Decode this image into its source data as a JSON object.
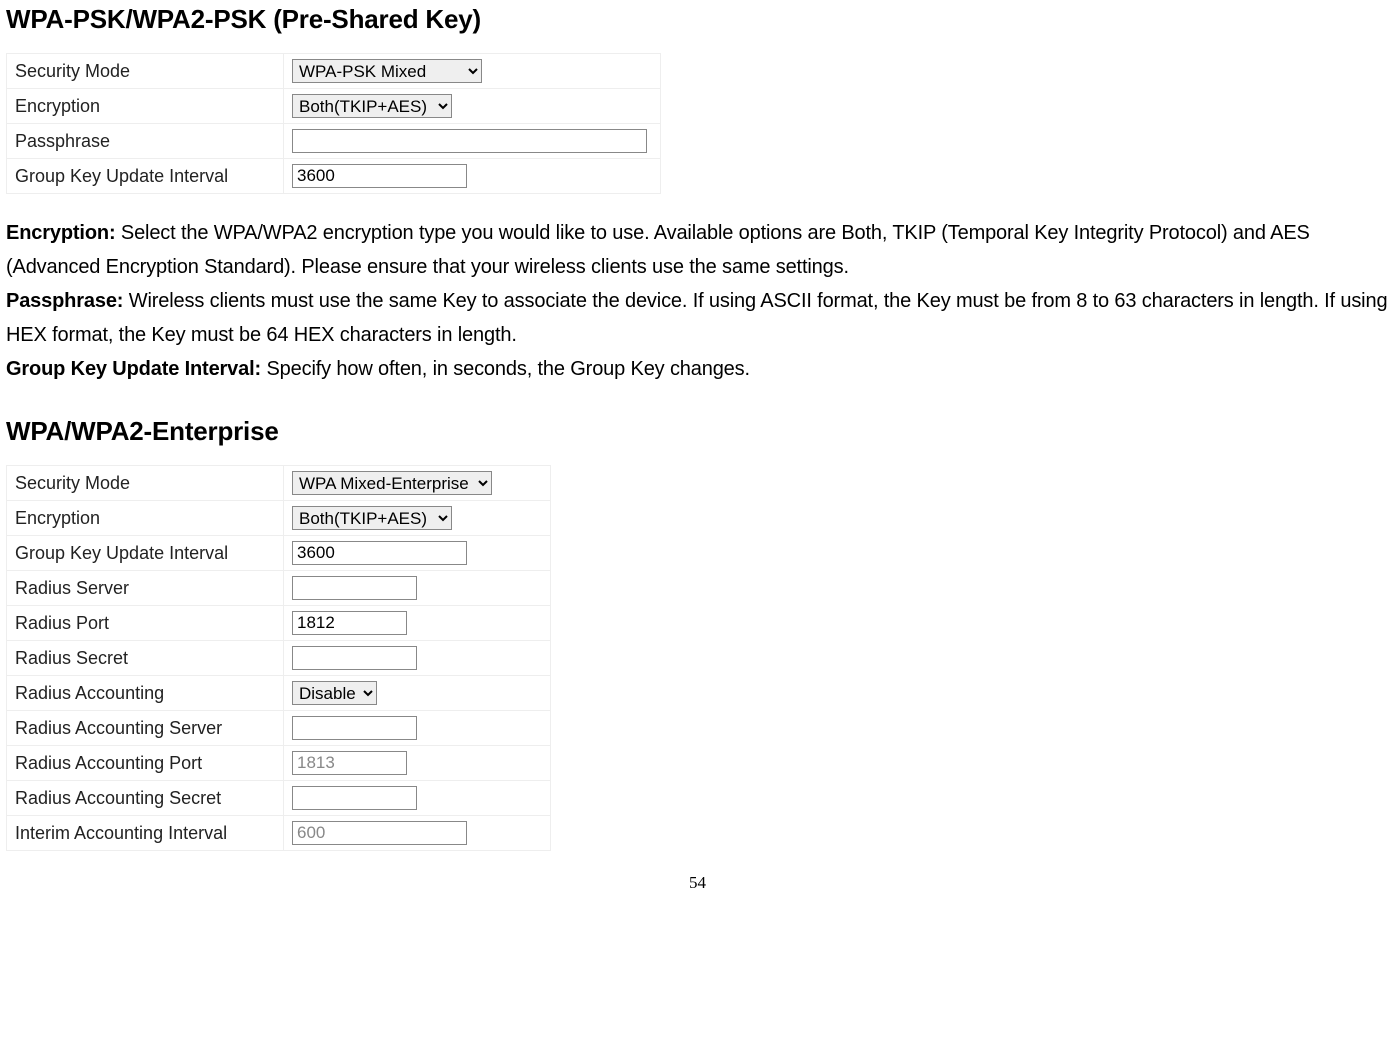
{
  "section1": {
    "title": "WPA-PSK/WPA2-PSK (Pre-Shared Key)",
    "rows": {
      "security_mode": {
        "label": "Security Mode",
        "value": "WPA-PSK Mixed"
      },
      "encryption": {
        "label": "Encryption",
        "value": "Both(TKIP+AES)"
      },
      "passphrase": {
        "label": "Passphrase",
        "value": ""
      },
      "gkui": {
        "label": "Group Key Update Interval",
        "value": "3600"
      }
    }
  },
  "descr": {
    "enc_label": "Encryption:",
    "enc_text": " Select the WPA/WPA2 encryption type you would like to use. Available options are Both, TKIP (Temporal Key Integrity Protocol) and AES (Advanced Encryption Standard). Please ensure that your wireless clients use the same settings.",
    "pass_label": "Passphrase:",
    "pass_text": " Wireless clients must use the same Key to associate the device. If using ASCII format, the Key must be from 8 to 63 characters in length. If using HEX format, the Key must be 64 HEX characters in length.",
    "gkui_label": "Group Key Update Interval:",
    "gkui_text": " Specify how often, in seconds, the Group Key changes."
  },
  "section2": {
    "title": "WPA/WPA2-Enterprise",
    "rows": {
      "security_mode": {
        "label": "Security Mode",
        "value": "WPA Mixed-Enterprise"
      },
      "encryption": {
        "label": "Encryption",
        "value": "Both(TKIP+AES)"
      },
      "gkui": {
        "label": "Group Key Update Interval",
        "value": "3600"
      },
      "radius_server": {
        "label": "Radius Server",
        "value": ""
      },
      "radius_port": {
        "label": "Radius Port",
        "value": "1812"
      },
      "radius_secret": {
        "label": "Radius Secret",
        "value": ""
      },
      "radius_accounting": {
        "label": "Radius Accounting",
        "value": "Disable"
      },
      "radius_acc_server": {
        "label": "Radius Accounting Server",
        "value": ""
      },
      "radius_acc_port": {
        "label": "Radius Accounting Port",
        "value": "1813"
      },
      "radius_acc_secret": {
        "label": "Radius Accounting Secret",
        "value": ""
      },
      "interim_interval": {
        "label": "Interim Accounting Interval",
        "value": "600"
      }
    }
  },
  "page_number": "54"
}
